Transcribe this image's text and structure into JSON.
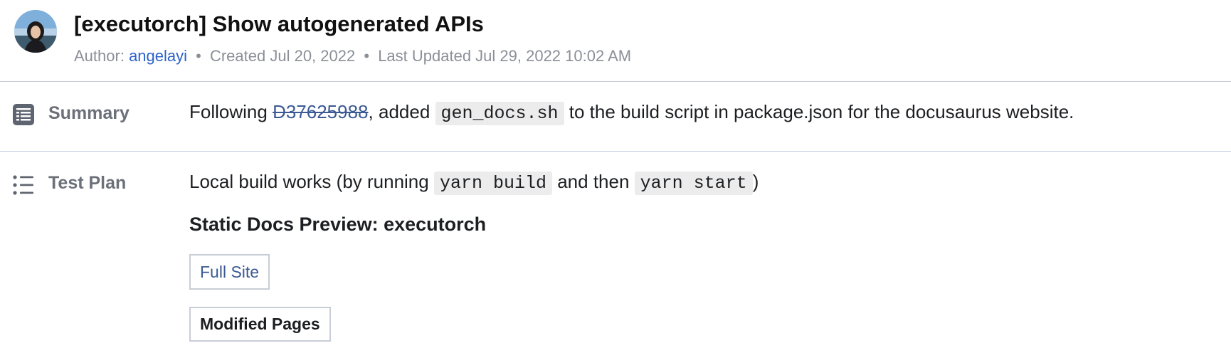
{
  "header": {
    "title": "[executorch] Show autogenerated APIs",
    "author_prefix": "Author:",
    "author": "angelayi",
    "created": "Created Jul 20, 2022",
    "updated": "Last Updated Jul 29, 2022 10:02 AM",
    "separator": "•"
  },
  "summary": {
    "label": "Summary",
    "icon": "document-lines-icon",
    "text_before": "Following ",
    "diff_link": "D37625988",
    "text_middle": ", added ",
    "code": "gen_docs.sh",
    "text_after": " to the build script in package.json for the docusaurus website."
  },
  "test_plan": {
    "label": "Test Plan",
    "icon": "bullet-list-icon",
    "text_before": "Local build works (by running ",
    "code_1": "yarn build",
    "text_middle": " and then ",
    "code_2": "yarn start",
    "text_after": ")",
    "preview_heading": "Static Docs Preview: executorch",
    "full_site_label": "Full Site",
    "modified_pages_label": "Modified Pages"
  },
  "colors": {
    "link": "#2c62c9",
    "muted": "#8a8f97",
    "divider": "#c4cedc",
    "code_bg": "#ececec"
  }
}
